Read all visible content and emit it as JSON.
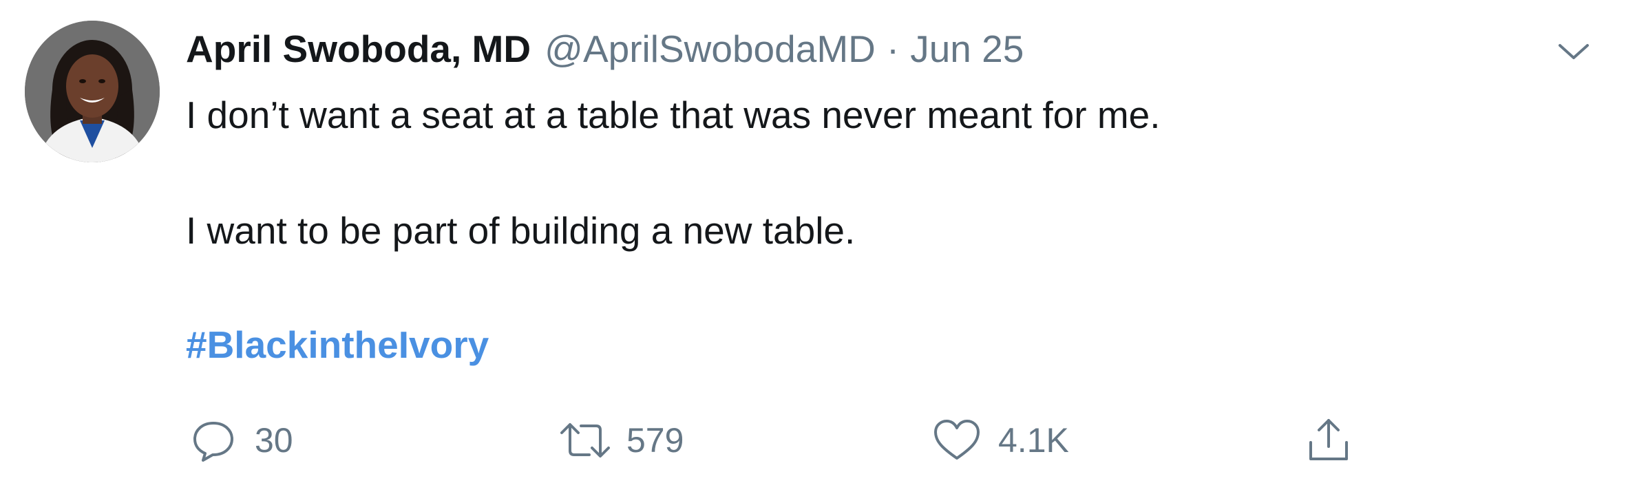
{
  "tweet": {
    "author_name": "April Swoboda, MD",
    "handle": "@AprilSwobodaMD",
    "separator": "·",
    "date": "Jun 25",
    "text_line1": "I don’t want a seat at a table that was never meant for me.",
    "text_line2": "I want to be part of building a new table.",
    "hashtag": "#BlackintheIvory",
    "hashtag_color": "#4a90e2"
  },
  "actions": {
    "reply_count": "30",
    "retweet_count": "579",
    "like_count": "4.1K"
  },
  "icons": {
    "reply": "reply-icon",
    "retweet": "retweet-icon",
    "like": "heart-icon",
    "share": "share-icon",
    "menu": "chevron-down-icon"
  },
  "colors": {
    "name": "#14171a",
    "secondary": "#657786",
    "link": "#4a90e2"
  }
}
